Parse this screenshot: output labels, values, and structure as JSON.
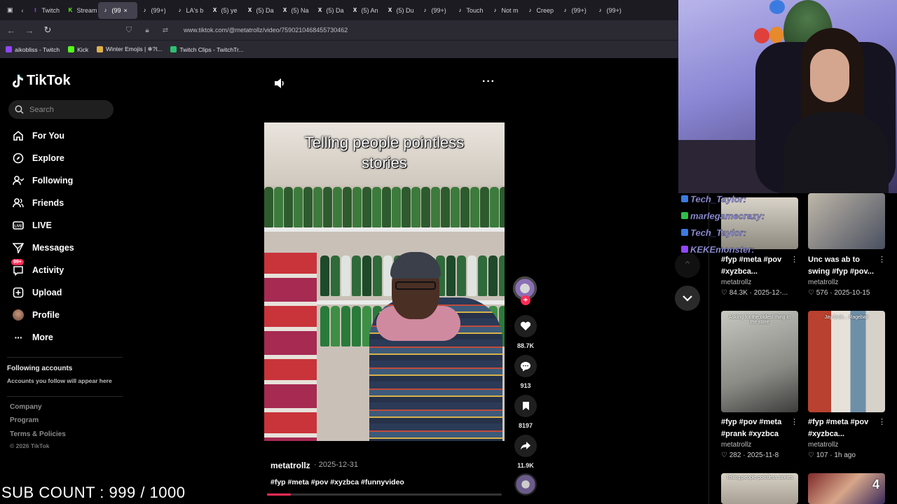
{
  "browser": {
    "tabs": [
      {
        "label": "Twitch",
        "color": "#9146ff",
        "glyph": "t"
      },
      {
        "label": "Stream",
        "color": "#53fc18",
        "glyph": "K"
      },
      {
        "label": "(99",
        "color": "#ffffff",
        "glyph": "♪",
        "active": true
      },
      {
        "label": "(99+)",
        "color": "#ffffff",
        "glyph": "♪"
      },
      {
        "label": "LA's b",
        "color": "#ffffff",
        "glyph": "♪"
      },
      {
        "label": "(5) ye",
        "color": "#ffffff",
        "glyph": "X"
      },
      {
        "label": "(5) Da",
        "color": "#ffffff",
        "glyph": "X"
      },
      {
        "label": "(5) Na",
        "color": "#ffffff",
        "glyph": "X"
      },
      {
        "label": "(5) Da",
        "color": "#ffffff",
        "glyph": "X"
      },
      {
        "label": "(5) An",
        "color": "#ffffff",
        "glyph": "X"
      },
      {
        "label": "(5) Du",
        "color": "#ffffff",
        "glyph": "X"
      },
      {
        "label": "(99+)",
        "color": "#ffffff",
        "glyph": "♪"
      },
      {
        "label": "Touch",
        "color": "#ffffff",
        "glyph": "♪"
      },
      {
        "label": "Not m",
        "color": "#ffffff",
        "glyph": "♪"
      },
      {
        "label": "Creep",
        "color": "#ffffff",
        "glyph": "♪"
      },
      {
        "label": "(99+)",
        "color": "#ffffff",
        "glyph": "♪"
      },
      {
        "label": "(99+)",
        "color": "#ffffff",
        "glyph": "♪"
      }
    ],
    "url": "www.tiktok.com/@metatrollz/video/7590210468455730462",
    "bookmarks": [
      {
        "label": "aikobliss - Twitch",
        "color": "#9146ff"
      },
      {
        "label": "Kick",
        "color": "#53fc18"
      },
      {
        "label": "Winter Emojis | ❄?l...",
        "color": "#e0b14a"
      },
      {
        "label": "Twitch Clips - TwitchTr...",
        "color": "#2fbf71"
      }
    ]
  },
  "sidebar": {
    "logo": "TikTok",
    "search_placeholder": "Search",
    "nav": [
      {
        "label": "For You",
        "icon": "home-icon"
      },
      {
        "label": "Explore",
        "icon": "compass-icon"
      },
      {
        "label": "Following",
        "icon": "following-icon"
      },
      {
        "label": "Friends",
        "icon": "friends-icon"
      },
      {
        "label": "LIVE",
        "icon": "live-icon"
      },
      {
        "label": "Messages",
        "icon": "paper-plane-icon"
      },
      {
        "label": "Activity",
        "icon": "activity-icon",
        "badge": "99+"
      },
      {
        "label": "Upload",
        "icon": "plus-square-icon"
      },
      {
        "label": "Profile",
        "icon": "avatar-icon"
      },
      {
        "label": "More",
        "icon": "ellipsis-icon"
      }
    ],
    "following_heading": "Following accounts",
    "following_sub": "Accounts you follow will appear here",
    "footer": [
      "Company",
      "Program",
      "Terms & Policies"
    ],
    "copyright": "© 2026 TikTok"
  },
  "video": {
    "caption_line1": "Telling people pointless",
    "caption_line2": "stories",
    "author": "metatrollz",
    "date": "· 2025-12-31",
    "hashtags": "#fyp #meta #pov #xyzbca #funnyvideo",
    "progress": 0.1,
    "likes": "88.7K",
    "comments": "913",
    "saves": "8197",
    "shares": "11.9K"
  },
  "grid": [
    {
      "title": "#fyp #meta #pov #xyzbca...",
      "author": "metatrollz",
      "likes": "84.3K",
      "date": "2025-12-..."
    },
    {
      "title": "Unc was ab to swing #fyp #pov...",
      "author": "metatrollz",
      "likes": "576",
      "date": "2025-10-15"
    },
    {
      "title": "#fyp #pov #meta #prank #xyzbca",
      "author": "metatrollz",
      "likes": "282",
      "date": "2025-11-8",
      "overlay": "Asking for the oldest thing in the store"
    },
    {
      "title": "#fyp #meta #pov #xyzbca...",
      "author": "metatrollz",
      "likes": "107",
      "date": "1h ago",
      "overlay": "Jay bruh... Ragebait"
    },
    {
      "overlay": "Telling people pointless stories"
    },
    {
      "overlay": "4"
    }
  ],
  "stream": {
    "chat": [
      {
        "name": "Tech_Taylor:",
        "color": "#9b9bd8"
      },
      {
        "name": "marlegamecrazy:",
        "color": "#9b9bd8"
      },
      {
        "name": "Tech_Taylor:",
        "color": "#9b9bd8"
      },
      {
        "name": "KEKEmonster:",
        "color": "#9b9bd8"
      }
    ],
    "sub_count": "SUB COUNT : 999 / 1000"
  },
  "colors": {
    "accent": "#fe2c55",
    "background": "#000000"
  }
}
